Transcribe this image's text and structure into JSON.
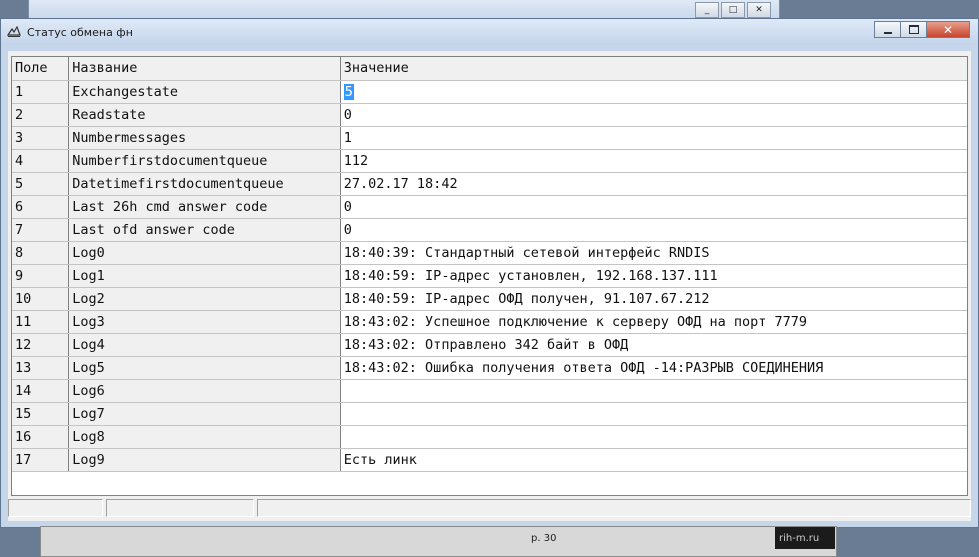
{
  "window": {
    "title": "Статус обмена фн"
  },
  "grid": {
    "headers": [
      "Поле",
      "Название",
      "Значение"
    ],
    "rows": [
      {
        "field": "1",
        "name": "Exchangestate",
        "value": "5"
      },
      {
        "field": "2",
        "name": "Readstate",
        "value": "0"
      },
      {
        "field": "3",
        "name": "Numbermessages",
        "value": "1"
      },
      {
        "field": "4",
        "name": "Numberfirstdocumentqueue",
        "value": "112"
      },
      {
        "field": "5",
        "name": "Datetimefirstdocumentqueue",
        "value": "27.02.17 18:42"
      },
      {
        "field": "6",
        "name": "Last 26h cmd answer code",
        "value": "0"
      },
      {
        "field": "7",
        "name": "Last ofd answer code",
        "value": "0"
      },
      {
        "field": "8",
        "name": "Log0",
        "value": "18:40:39: Стандартный сетевой интерфейс RNDIS"
      },
      {
        "field": "9",
        "name": "Log1",
        "value": "18:40:59: IP-адрес установлен, 192.168.137.111"
      },
      {
        "field": "10",
        "name": "Log2",
        "value": "18:40:59: IP-адрес ОФД получен, 91.107.67.212"
      },
      {
        "field": "11",
        "name": "Log3",
        "value": "18:43:02: Успешное подключение к серверу ОФД на порт 7779"
      },
      {
        "field": "12",
        "name": "Log4",
        "value": "18:43:02: Отправлено 342 байт в ОФД"
      },
      {
        "field": "13",
        "name": "Log5",
        "value": "18:43:02: Ошибка получения ответа ОФД -14:РАЗРЫВ СОЕДИНЕНИЯ"
      },
      {
        "field": "14",
        "name": "Log6",
        "value": ""
      },
      {
        "field": "15",
        "name": "Log7",
        "value": ""
      },
      {
        "field": "16",
        "name": "Log8",
        "value": ""
      },
      {
        "field": "17",
        "name": "Log9",
        "value": "Есть линк"
      }
    ]
  },
  "background": {
    "footer_text": "р. 30",
    "corner_text": "rih-m.ru"
  },
  "colors": {
    "selection": "#3399ff",
    "close_button": "#c7442b"
  }
}
